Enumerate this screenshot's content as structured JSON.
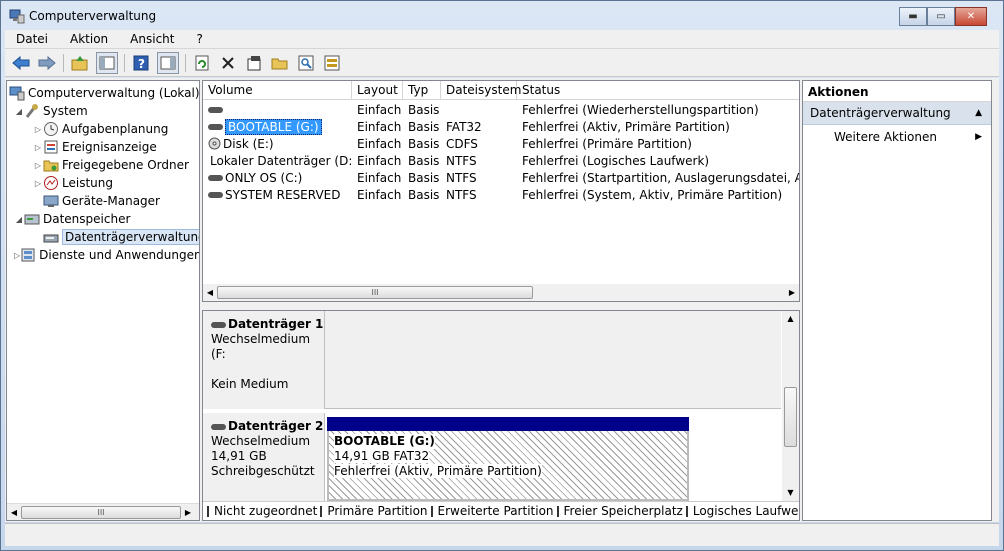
{
  "window": {
    "title": "Computerverwaltung"
  },
  "window_controls": {
    "minimize": "▬",
    "maximize": "▭",
    "close": "✕"
  },
  "menu": [
    "Datei",
    "Aktion",
    "Ansicht",
    "?"
  ],
  "toolbar_icons": [
    "back-arrow-icon",
    "forward-arrow-icon",
    "up-folder-icon",
    "show-hide-tree-icon",
    "help-icon",
    "show-hide-action-pane-icon",
    "refresh-icon",
    "delete-icon",
    "properties-icon",
    "open-folder-icon",
    "search-icon",
    "disk-settings-icon"
  ],
  "tree": {
    "root": "Computerverwaltung (Lokal)",
    "system": "System",
    "aufgaben": "Aufgabenplanung",
    "ereignis": "Ereignisanzeige",
    "freigegeben": "Freigegebene Ordner",
    "leistung": "Leistung",
    "geraete": "Geräte-Manager",
    "datenspeicher": "Datenspeicher",
    "datentraeger": "Datenträgerverwaltung",
    "dienste": "Dienste und Anwendungen",
    "scroll_thumb": "III"
  },
  "volumes": {
    "columns": [
      "Volume",
      "Layout",
      "Typ",
      "Dateisystem",
      "Status"
    ],
    "rows": [
      {
        "volume": "",
        "layout": "Einfach",
        "typ": "Basis",
        "fs": "",
        "status": "Fehlerfrei (Wiederherstellungspartition)"
      },
      {
        "volume": "BOOTABLE (G:)",
        "layout": "Einfach",
        "typ": "Basis",
        "fs": "FAT32",
        "status": "Fehlerfrei (Aktiv, Primäre Partition)"
      },
      {
        "volume": "Disk (E:)",
        "layout": "Einfach",
        "typ": "Basis",
        "fs": "CDFS",
        "status": "Fehlerfrei (Primäre Partition)"
      },
      {
        "volume": "Lokaler Datenträger (D:)",
        "layout": "Einfach",
        "typ": "Basis",
        "fs": "NTFS",
        "status": "Fehlerfrei (Logisches Laufwerk)"
      },
      {
        "volume": "ONLY OS (C:)",
        "layout": "Einfach",
        "typ": "Basis",
        "fs": "NTFS",
        "status": "Fehlerfrei (Startpartition, Auslagerungsdatei, Absturz"
      },
      {
        "volume": "SYSTEM RESERVED",
        "layout": "Einfach",
        "typ": "Basis",
        "fs": "NTFS",
        "status": "Fehlerfrei (System, Aktiv, Primäre Partition)"
      }
    ],
    "scroll_thumb": "III"
  },
  "disks": {
    "disk1": {
      "title": "Datenträger 1",
      "type": "Wechselmedium (F:",
      "media": "Kein Medium"
    },
    "disk2": {
      "title": "Datenträger 2",
      "type": "Wechselmedium",
      "size": "14,91 GB",
      "state": "Schreibgeschützt",
      "partition": {
        "name": "BOOTABLE  (G:)",
        "size_fs": "14,91 GB FAT32",
        "status": "Fehlerfrei (Aktiv, Primäre Partition)"
      }
    }
  },
  "legend": [
    {
      "label": "Nicht zugeordnet",
      "color": "#000000"
    },
    {
      "label": "Primäre Partition",
      "color": "#00008b"
    },
    {
      "label": "Erweiterte Partition",
      "color": "#008000"
    },
    {
      "label": "Freier Speicherplatz",
      "color": "#33ff33"
    },
    {
      "label": "Logisches Laufwerk",
      "color": "#0000ff"
    }
  ],
  "actions": {
    "header": "Aktionen",
    "section": "Datenträgerverwaltung",
    "more": "Weitere Aktionen"
  }
}
